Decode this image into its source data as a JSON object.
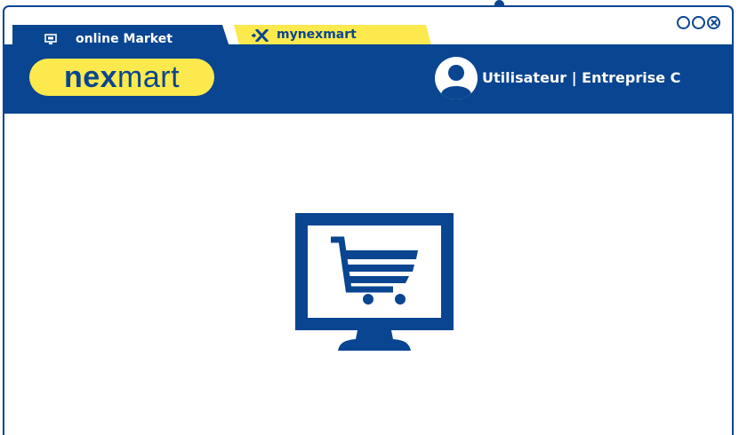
{
  "tabs": [
    {
      "label": "online Market",
      "icon": "monitor-icon",
      "active": true
    },
    {
      "label": "mynexmart",
      "icon": "nexmart-x-icon",
      "active": false
    }
  ],
  "window_controls": [
    "minimize",
    "maximize",
    "close"
  ],
  "header": {
    "logo_bold": "nex",
    "logo_light": "mart",
    "user_label": "Utilisateur | Entreprise C"
  },
  "main": {
    "icon": "monitor-shopping-cart-icon"
  },
  "colors": {
    "brand_blue": "#0a4591",
    "brand_yellow": "#fbe94d",
    "background": "#ffffff"
  }
}
